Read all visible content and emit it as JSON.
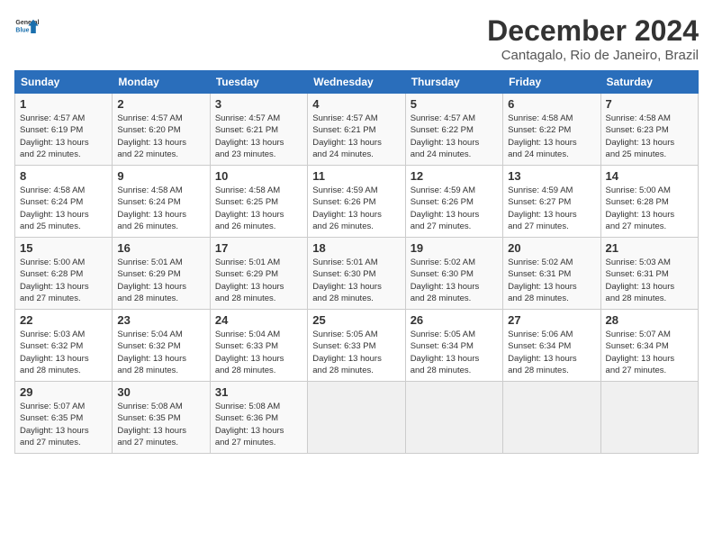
{
  "logo": {
    "line1": "General",
    "line2": "Blue"
  },
  "title": "December 2024",
  "subtitle": "Cantagalo, Rio de Janeiro, Brazil",
  "headers": [
    "Sunday",
    "Monday",
    "Tuesday",
    "Wednesday",
    "Thursday",
    "Friday",
    "Saturday"
  ],
  "weeks": [
    [
      {
        "day": "1",
        "info": "Sunrise: 4:57 AM\nSunset: 6:19 PM\nDaylight: 13 hours\nand 22 minutes."
      },
      {
        "day": "2",
        "info": "Sunrise: 4:57 AM\nSunset: 6:20 PM\nDaylight: 13 hours\nand 22 minutes."
      },
      {
        "day": "3",
        "info": "Sunrise: 4:57 AM\nSunset: 6:21 PM\nDaylight: 13 hours\nand 23 minutes."
      },
      {
        "day": "4",
        "info": "Sunrise: 4:57 AM\nSunset: 6:21 PM\nDaylight: 13 hours\nand 24 minutes."
      },
      {
        "day": "5",
        "info": "Sunrise: 4:57 AM\nSunset: 6:22 PM\nDaylight: 13 hours\nand 24 minutes."
      },
      {
        "day": "6",
        "info": "Sunrise: 4:58 AM\nSunset: 6:22 PM\nDaylight: 13 hours\nand 24 minutes."
      },
      {
        "day": "7",
        "info": "Sunrise: 4:58 AM\nSunset: 6:23 PM\nDaylight: 13 hours\nand 25 minutes."
      }
    ],
    [
      {
        "day": "8",
        "info": "Sunrise: 4:58 AM\nSunset: 6:24 PM\nDaylight: 13 hours\nand 25 minutes."
      },
      {
        "day": "9",
        "info": "Sunrise: 4:58 AM\nSunset: 6:24 PM\nDaylight: 13 hours\nand 26 minutes."
      },
      {
        "day": "10",
        "info": "Sunrise: 4:58 AM\nSunset: 6:25 PM\nDaylight: 13 hours\nand 26 minutes."
      },
      {
        "day": "11",
        "info": "Sunrise: 4:59 AM\nSunset: 6:26 PM\nDaylight: 13 hours\nand 26 minutes."
      },
      {
        "day": "12",
        "info": "Sunrise: 4:59 AM\nSunset: 6:26 PM\nDaylight: 13 hours\nand 27 minutes."
      },
      {
        "day": "13",
        "info": "Sunrise: 4:59 AM\nSunset: 6:27 PM\nDaylight: 13 hours\nand 27 minutes."
      },
      {
        "day": "14",
        "info": "Sunrise: 5:00 AM\nSunset: 6:28 PM\nDaylight: 13 hours\nand 27 minutes."
      }
    ],
    [
      {
        "day": "15",
        "info": "Sunrise: 5:00 AM\nSunset: 6:28 PM\nDaylight: 13 hours\nand 27 minutes."
      },
      {
        "day": "16",
        "info": "Sunrise: 5:01 AM\nSunset: 6:29 PM\nDaylight: 13 hours\nand 28 minutes."
      },
      {
        "day": "17",
        "info": "Sunrise: 5:01 AM\nSunset: 6:29 PM\nDaylight: 13 hours\nand 28 minutes."
      },
      {
        "day": "18",
        "info": "Sunrise: 5:01 AM\nSunset: 6:30 PM\nDaylight: 13 hours\nand 28 minutes."
      },
      {
        "day": "19",
        "info": "Sunrise: 5:02 AM\nSunset: 6:30 PM\nDaylight: 13 hours\nand 28 minutes."
      },
      {
        "day": "20",
        "info": "Sunrise: 5:02 AM\nSunset: 6:31 PM\nDaylight: 13 hours\nand 28 minutes."
      },
      {
        "day": "21",
        "info": "Sunrise: 5:03 AM\nSunset: 6:31 PM\nDaylight: 13 hours\nand 28 minutes."
      }
    ],
    [
      {
        "day": "22",
        "info": "Sunrise: 5:03 AM\nSunset: 6:32 PM\nDaylight: 13 hours\nand 28 minutes."
      },
      {
        "day": "23",
        "info": "Sunrise: 5:04 AM\nSunset: 6:32 PM\nDaylight: 13 hours\nand 28 minutes."
      },
      {
        "day": "24",
        "info": "Sunrise: 5:04 AM\nSunset: 6:33 PM\nDaylight: 13 hours\nand 28 minutes."
      },
      {
        "day": "25",
        "info": "Sunrise: 5:05 AM\nSunset: 6:33 PM\nDaylight: 13 hours\nand 28 minutes."
      },
      {
        "day": "26",
        "info": "Sunrise: 5:05 AM\nSunset: 6:34 PM\nDaylight: 13 hours\nand 28 minutes."
      },
      {
        "day": "27",
        "info": "Sunrise: 5:06 AM\nSunset: 6:34 PM\nDaylight: 13 hours\nand 28 minutes."
      },
      {
        "day": "28",
        "info": "Sunrise: 5:07 AM\nSunset: 6:34 PM\nDaylight: 13 hours\nand 27 minutes."
      }
    ],
    [
      {
        "day": "29",
        "info": "Sunrise: 5:07 AM\nSunset: 6:35 PM\nDaylight: 13 hours\nand 27 minutes."
      },
      {
        "day": "30",
        "info": "Sunrise: 5:08 AM\nSunset: 6:35 PM\nDaylight: 13 hours\nand 27 minutes."
      },
      {
        "day": "31",
        "info": "Sunrise: 5:08 AM\nSunset: 6:36 PM\nDaylight: 13 hours\nand 27 minutes."
      },
      {
        "day": "",
        "info": ""
      },
      {
        "day": "",
        "info": ""
      },
      {
        "day": "",
        "info": ""
      },
      {
        "day": "",
        "info": ""
      }
    ]
  ]
}
